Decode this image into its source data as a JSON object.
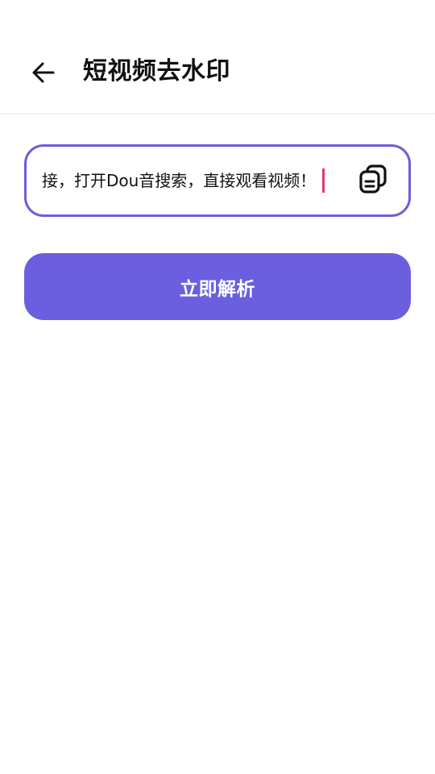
{
  "header": {
    "title": "短视频去水印",
    "back_icon": "arrow-left-icon"
  },
  "input": {
    "value": "接，打开Dou音搜索，直接观看视频！",
    "border_color": "#6b5fd8",
    "caret_color": "#e6347a",
    "paste_icon": "copy-paste-icon"
  },
  "actions": {
    "parse_label": "立即解析",
    "parse_color": "#6b5fdf"
  }
}
